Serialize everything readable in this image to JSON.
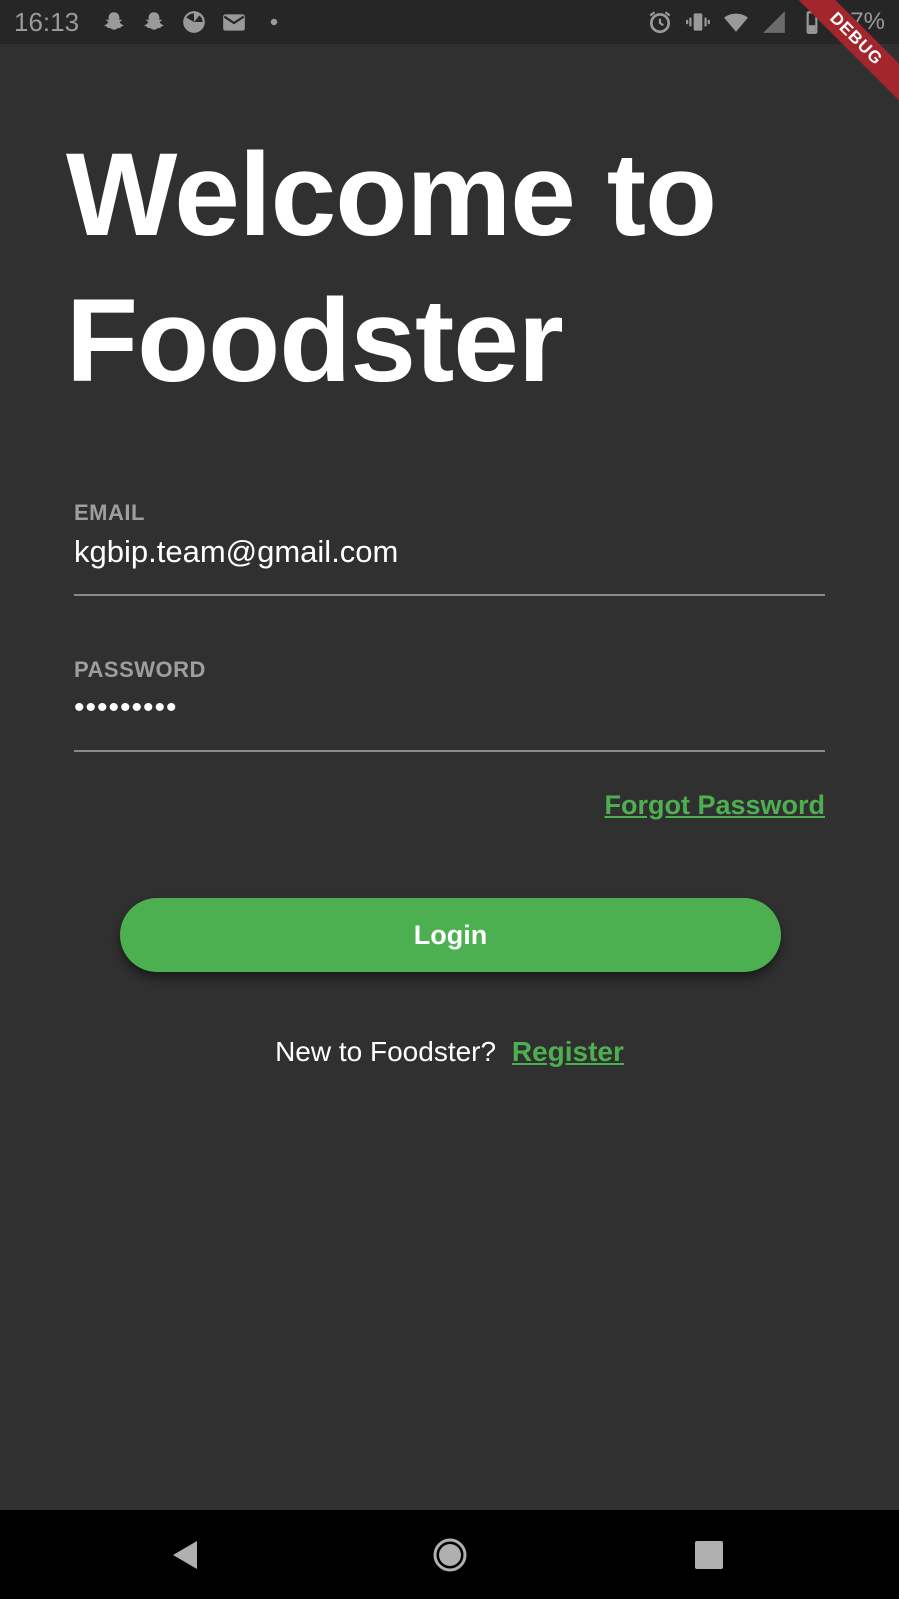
{
  "status_bar": {
    "time": "16:13",
    "battery": "27%",
    "left_icons": [
      "snapchat-icon",
      "snapchat-icon",
      "pie-icon",
      "mail-icon",
      "dot-icon"
    ],
    "right_icons": [
      "alarm-icon",
      "vibrate-icon",
      "wifi-icon",
      "signal-icon",
      "battery-icon"
    ]
  },
  "debug_banner": "DEBUG",
  "title": "Welcome to Foodster",
  "email": {
    "label": "EMAIL",
    "value": "kgbip.team@gmail.com"
  },
  "password": {
    "label": "PASSWORD",
    "value": "•••••••••"
  },
  "forgot_password": "Forgot Password",
  "login_button": "Login",
  "register": {
    "prompt": "New to Foodster?",
    "link": "Register"
  },
  "nav_bar": {
    "buttons": [
      "back-icon",
      "home-icon",
      "recents-icon"
    ]
  },
  "colors": {
    "background": "#303030",
    "accent": "#4caf50",
    "debug": "#a3262c"
  }
}
